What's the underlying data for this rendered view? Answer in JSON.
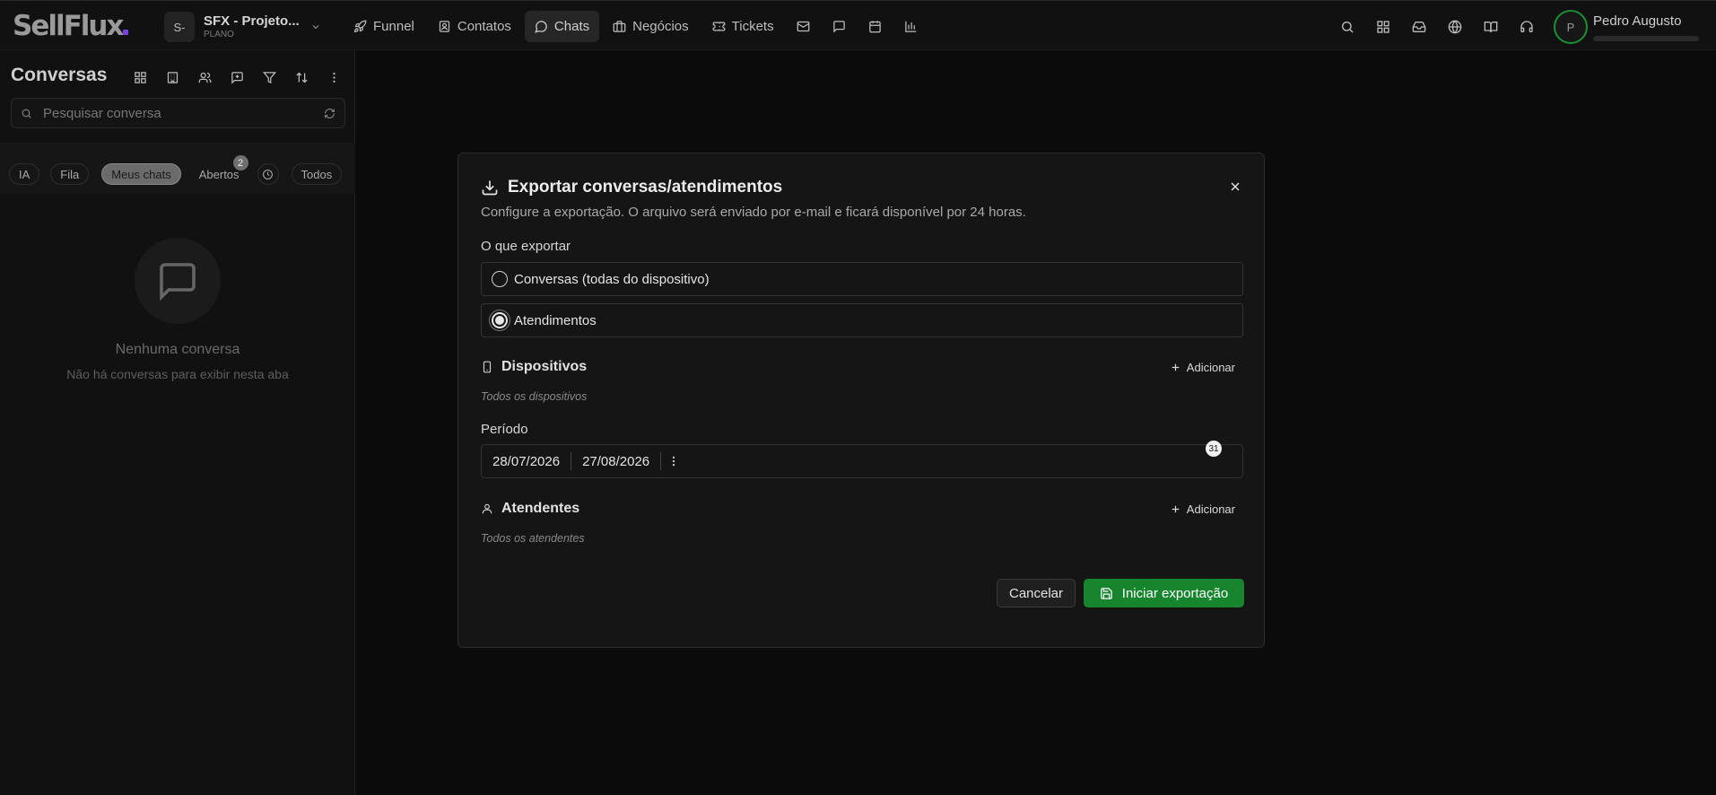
{
  "brand": {
    "logo_text": "SellFlux",
    "accent": "#7b3fe4",
    "success": "#17852e"
  },
  "project": {
    "initials": "S-",
    "name": "SFX - Projeto...",
    "plan": "PLANO"
  },
  "nav": [
    {
      "label": "Funnel",
      "icon": "rocket-icon"
    },
    {
      "label": "Contatos",
      "icon": "contact-icon"
    },
    {
      "label": "Chats",
      "icon": "chat-icon",
      "active": true
    },
    {
      "label": "Negócios",
      "icon": "briefcase-icon"
    },
    {
      "label": "Tickets",
      "icon": "ticket-icon"
    }
  ],
  "nav_icons": [
    "mail-icon",
    "message-square-icon",
    "calendar-icon",
    "bar-chart-icon"
  ],
  "header_icons": [
    "search-icon",
    "apps-grid-icon",
    "inbox-icon",
    "globe-icon",
    "book-icon",
    "headset-icon"
  ],
  "user": {
    "initial": "P",
    "name": "Pedro Augusto"
  },
  "sidebar": {
    "title": "Conversas",
    "tools": [
      "grid-icon",
      "building-icon",
      "users-icon",
      "new-message-icon",
      "filter-icon",
      "sort-icon",
      "more-vertical-icon"
    ],
    "search_placeholder": "Pesquisar conversa",
    "chips": {
      "ia": "IA",
      "fila": "Fila",
      "meus_chats": "Meus chats",
      "abertos": "Abertos",
      "abertos_count": "2",
      "todos": "Todos"
    },
    "empty": {
      "title": "Nenhuma conversa",
      "subtitle": "Não há conversas para exibir nesta aba"
    }
  },
  "modal": {
    "title": "Exportar conversas/atendimentos",
    "description": "Configure a exportação. O arquivo será enviado por e-mail e ficará disponível por 24 horas.",
    "export_label": "O que exportar",
    "options": {
      "conversas": "Conversas (todas do dispositivo)",
      "atendimentos": "Atendimentos"
    },
    "selected_option": "atendimentos",
    "devices": {
      "title": "Dispositivos",
      "add": "Adicionar",
      "hint": "Todos os dispositivos"
    },
    "period": {
      "label": "Período",
      "start": "28/07/2026",
      "end": "27/08/2026",
      "days": "31"
    },
    "agents": {
      "title": "Atendentes",
      "add": "Adicionar",
      "hint": "Todos os atendentes"
    },
    "cancel": "Cancelar",
    "submit": "Iniciar exportação"
  }
}
